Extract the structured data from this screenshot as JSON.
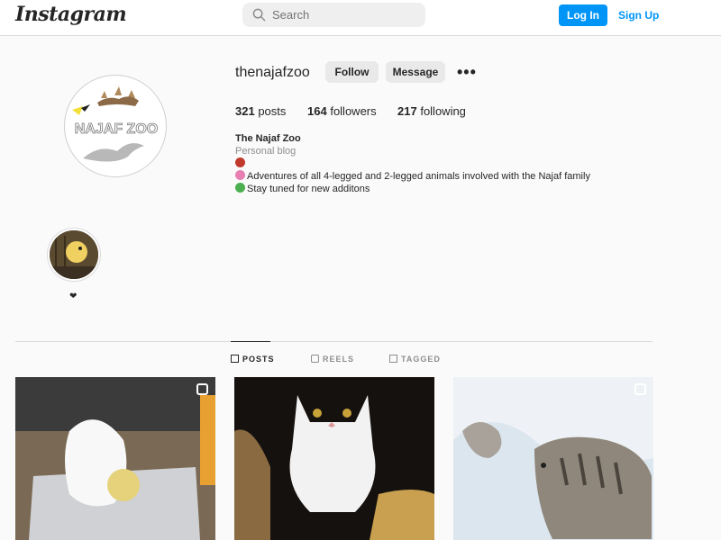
{
  "header": {
    "logo_text": "Instagram",
    "search_placeholder": "Search",
    "login_label": "Log In",
    "signup_label": "Sign Up"
  },
  "profile": {
    "username": "thenajafzoo",
    "follow_label": "Follow",
    "message_label": "Message",
    "more_label": "•••",
    "avatar_text": "NAJAF ZOO",
    "stats": {
      "posts_count": "321",
      "posts_label": "posts",
      "followers_count": "164",
      "followers_label": "followers",
      "following_count": "217",
      "following_label": "following"
    },
    "bio": {
      "name": "The Najaf Zoo",
      "category": "Personal blog",
      "line1": "Adventures of all 4-legged and 2-legged animals involved with the Najaf family",
      "line2": "Stay tuned for new additons"
    }
  },
  "highlights": [
    {
      "label": "❤"
    }
  ],
  "tabs": [
    {
      "label": "POSTS",
      "active": true
    },
    {
      "label": "REELS",
      "active": false
    },
    {
      "label": "TAGGED",
      "active": false
    }
  ],
  "colors": {
    "accent": "#0095f6",
    "background": "#fafafa",
    "divider": "#dbdbdb"
  }
}
